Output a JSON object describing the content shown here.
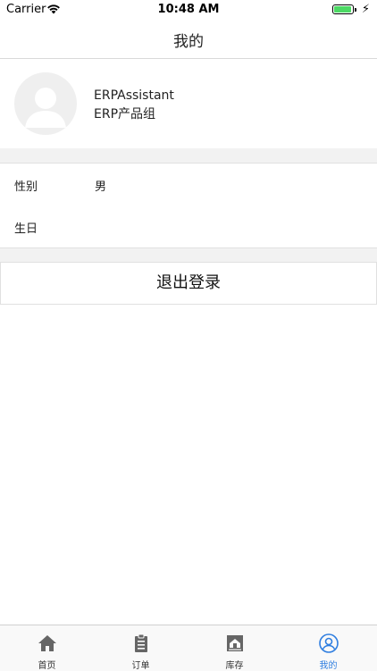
{
  "status_bar": {
    "carrier": "Carrier",
    "time": "10:48 AM",
    "battery_color": "#4cd964"
  },
  "nav": {
    "title": "我的"
  },
  "profile": {
    "username": "ERPAssistant",
    "group": "ERP产品组"
  },
  "info_rows": [
    {
      "label": "性别",
      "value": "男"
    },
    {
      "label": "生日",
      "value": ""
    }
  ],
  "logout_label": "退出登录",
  "tabbar": {
    "active_color": "#2f7ee0",
    "items": [
      {
        "label": "首页",
        "icon": "home-icon"
      },
      {
        "label": "订单",
        "icon": "clipboard-icon"
      },
      {
        "label": "库存",
        "icon": "warehouse-icon"
      },
      {
        "label": "我的",
        "icon": "user-circle-icon",
        "active": true
      }
    ]
  }
}
